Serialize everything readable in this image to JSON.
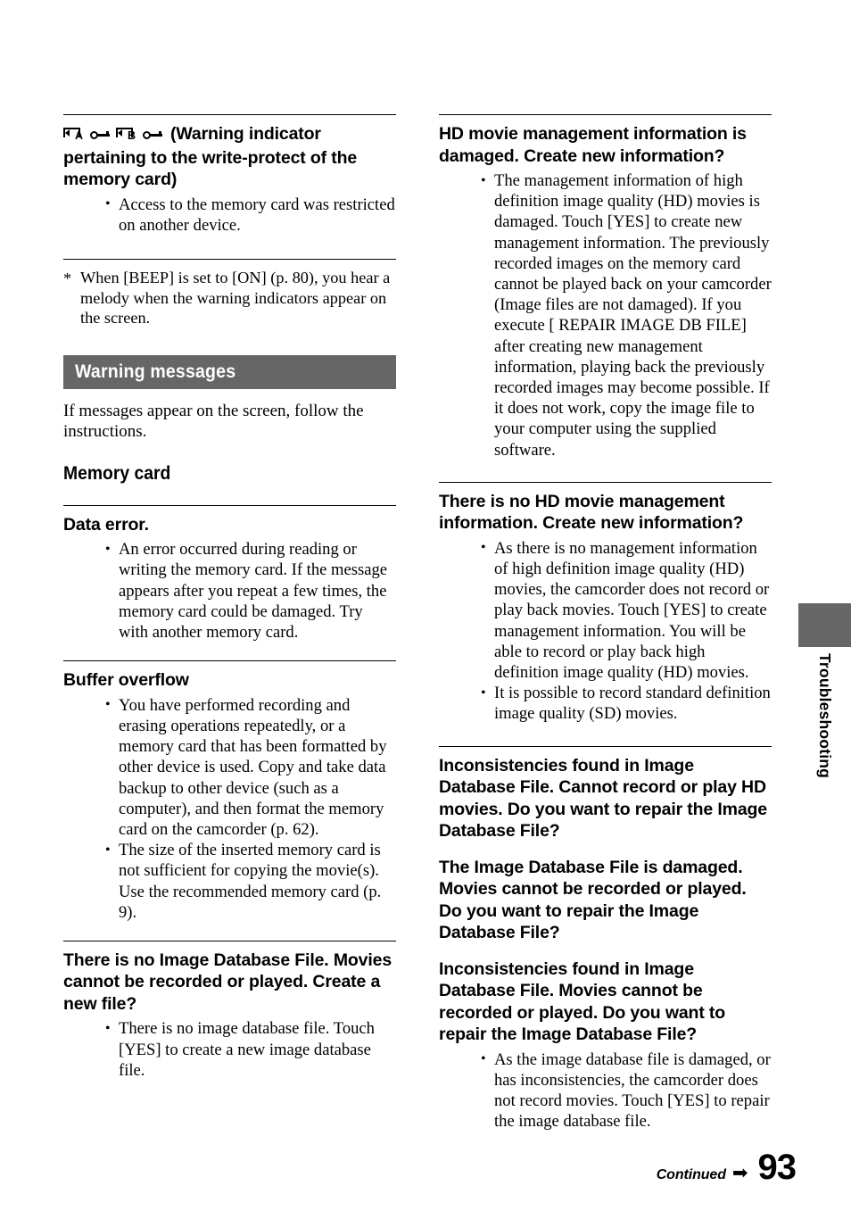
{
  "page": {
    "number": "93",
    "continued_label": "Continued",
    "continued_arrow": "➡",
    "side_tab_label": "Troubleshooting",
    "band_color": "#666666",
    "side_tab_color": "#666666"
  },
  "left_column": {
    "write_protect_section": {
      "icons": [
        {
          "name": "memory-card-a-icon",
          "letter": "A"
        },
        {
          "name": "write-protect-key-icon-a",
          "letter": ""
        },
        {
          "name": "memory-card-b-icon",
          "letter": "B"
        },
        {
          "name": "write-protect-key-icon-b",
          "letter": ""
        }
      ],
      "title": "(Warning indicator pertaining to the write-protect of the memory card)",
      "bullets": [
        "Access to the memory card was restricted on another device."
      ]
    },
    "footnote": {
      "marker": "*",
      "text": "When [BEEP] is set to [ON] (p. 80), you hear a melody when the warning indicators appear on the screen."
    },
    "warning_messages_band": "Warning messages",
    "intro_text": "If messages appear on the screen, follow the instructions.",
    "memory_card_heading": "Memory card",
    "messages": [
      {
        "title": "Data error.",
        "bullets": [
          "An error occurred during reading or writing the memory card. If the message appears after you repeat a few times, the memory card could be damaged. Try with another memory card."
        ]
      },
      {
        "title": "Buffer overflow",
        "bullets": [
          "You have performed recording and erasing operations repeatedly, or a memory card that has been formatted by other device is used. Copy and take data backup to other device (such as a computer), and then format the memory card on the camcorder (p. 62).",
          "The size of the inserted memory card is not sufficient for copying the movie(s). Use the recommended memory card (p. 9)."
        ]
      },
      {
        "title": "There is no Image Database File. Movies cannot be recorded or played. Create a new file?",
        "bullets": [
          "There is no image database file. Touch [YES] to create a new image database file."
        ]
      }
    ]
  },
  "right_column": {
    "messages": [
      {
        "title": "HD movie management information is damaged. Create new information?",
        "bullets": [
          "The management information of high definition image quality (HD) movies is damaged. Touch [YES] to create new management information. The previously recorded images on the memory card cannot be played back on your camcorder (Image files are not damaged). If you execute [ REPAIR IMAGE DB FILE] after creating new management information, playing back the previously recorded images may become possible. If it does not work, copy the image file to your computer using the supplied software."
        ]
      },
      {
        "title": "There is no HD movie management information. Create new information?",
        "bullets": [
          "As there is no management information of high definition image quality (HD) movies, the camcorder does not record or play back movies. Touch [YES] to create management information. You will be able to record or play back high definition image quality (HD) movies.",
          "It is possible to record standard definition image quality (SD) movies."
        ]
      },
      {
        "title": "Inconsistencies found in Image Database File. Cannot record or play HD movies. Do you want to repair the Image Database File?",
        "bullets": []
      },
      {
        "title": "The Image Database File is damaged. Movies cannot be recorded or played. Do you want to repair the Image Database File?",
        "bullets": []
      },
      {
        "title": "Inconsistencies found in Image Database File. Movies cannot be recorded or played. Do you want to repair the Image Database File?",
        "bullets": [
          "As the image database file is damaged, or has inconsistencies, the camcorder does not record movies. Touch [YES] to repair the image database file."
        ]
      }
    ]
  }
}
